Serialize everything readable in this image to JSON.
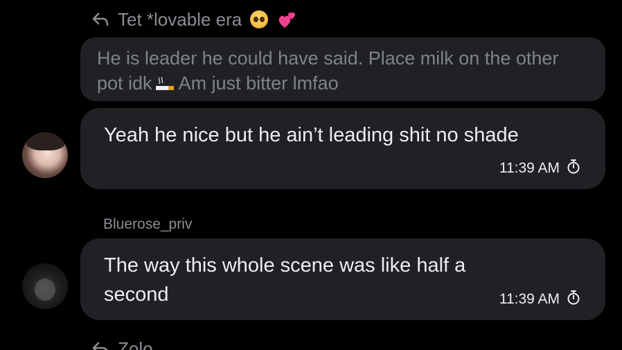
{
  "reply_1": {
    "author": "Tet *lovable era",
    "quoted_line_1": "He is leader he could have said. Place milk on the other",
    "quoted_line_2a": "pot idk",
    "quoted_line_2b": "Am just bitter lmfao"
  },
  "messages": [
    {
      "text": "Yeah he nice but he ain’t leading shit no shade",
      "time": "11:39 AM"
    },
    {
      "sender": "Bluerose_priv",
      "text": "The way this whole scene was like half a second",
      "time": "11:39 AM"
    }
  ],
  "reply_2": {
    "author": "Zolo"
  },
  "colors": {
    "background": "#000000",
    "bubble": "#202124",
    "text": "#eceef1",
    "muted": "#8a8d93"
  }
}
